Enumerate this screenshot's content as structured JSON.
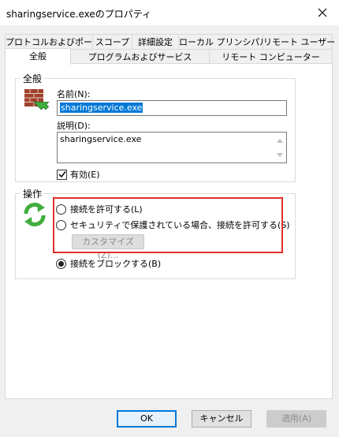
{
  "window": {
    "title": "sharingservice.exeのプロパティ",
    "close_glyph": "✕"
  },
  "tabs": {
    "row1": [
      "プロトコルおよびポート",
      "スコープ",
      "詳細設定",
      "ローカル プリンシパル",
      "リモート ユーザー"
    ],
    "row2": [
      "全般",
      "プログラムおよびサービス",
      "リモート コンピューター"
    ],
    "active": "全般"
  },
  "general": {
    "legend": "全般",
    "icon": "firewall-brick-icon",
    "name_label": "名前(N):",
    "name_value": "sharingservice.exe",
    "description_label": "説明(D):",
    "description_value": "sharingservice.exe",
    "enabled_label": "有効(E)",
    "enabled_checked": true
  },
  "action": {
    "legend": "操作",
    "icon": "arrows-refresh-icon",
    "allow_label": "接続を許可する(L)",
    "allow_secure_label": "セキュリティで保護されている場合、接続を許可する(S)",
    "customize_label": "カスタマイズ(Z)...",
    "block_label": "接続をブロックする(B)",
    "selected": "block"
  },
  "buttons": {
    "ok": "OK",
    "cancel": "キャンセル",
    "apply": "適用(A)"
  },
  "colors": {
    "highlight": "#e0302a",
    "selection": "#0078d7"
  }
}
